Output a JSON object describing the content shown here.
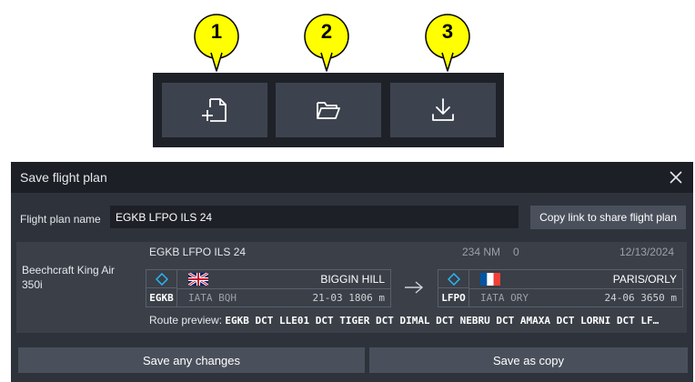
{
  "callouts": [
    "1",
    "2",
    "3"
  ],
  "toolbar": {
    "buttons": [
      {
        "icon": "new-file-icon"
      },
      {
        "icon": "open-folder-icon"
      },
      {
        "icon": "download-icon"
      }
    ]
  },
  "dialog": {
    "title": "Save flight plan",
    "flight_plan_name_label": "Flight plan name",
    "flight_plan_name_value": "EGKB LFPO ILS 24",
    "copy_link_label": "Copy link to share flight plan",
    "card": {
      "aircraft": "Beechcraft King Air 350i",
      "plan_name": "EGKB LFPO ILS 24",
      "distance": "234 NM",
      "count": "0",
      "date": "12/13/2024",
      "departure": {
        "icao": "EGKB",
        "iata": "IATA BQH",
        "name": "BIGGIN HILL",
        "info": "21-03 1806 m",
        "flag": "uk-flag-icon"
      },
      "arrival": {
        "icao": "LFPO",
        "iata": "IATA ORY",
        "name": "PARIS/ORLY",
        "info": "24-06 3650 m",
        "flag": "france-flag-icon"
      },
      "route_label": "Route preview:",
      "route_text": "EGKB DCT LLE01 DCT TIGER DCT DIMAL DCT NEBRU DCT AMAXA DCT LORNI DCT LF…"
    },
    "save_changes_label": "Save any changes",
    "save_copy_label": "Save as copy"
  },
  "colors": {
    "callout_fill": "#ffff00",
    "toolbar_bg": "#1e2128",
    "button_bg": "#3d434e",
    "dialog_bg": "#2e333b",
    "header_bg": "#1c1f25",
    "waypoint_cyan": "#29b6f6"
  }
}
